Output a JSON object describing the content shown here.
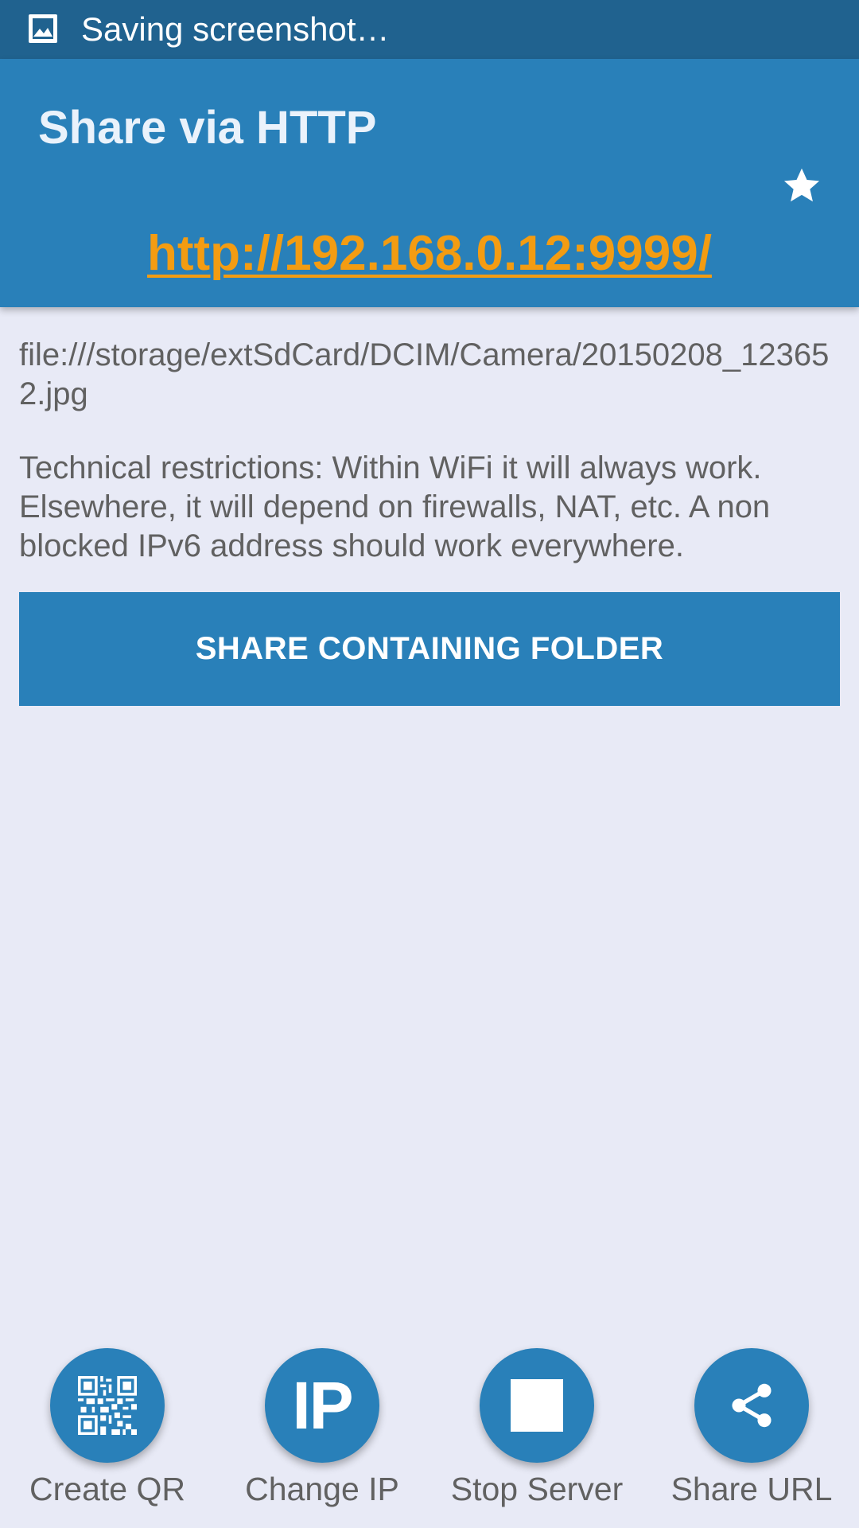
{
  "status_bar": {
    "notification_text": "Saving screenshot…",
    "icon": "image-icon"
  },
  "app_bar": {
    "title": "Share via HTTP",
    "action_icon": "star-icon",
    "server_url": "http://192.168.0.12:9999/"
  },
  "content": {
    "file_path": "file:///storage/extSdCard/DCIM/Camera/20150208_123652.jpg",
    "restrictions_text": "Technical restrictions: Within WiFi it will always work. Elsewhere, it will depend on firewalls, NAT, etc. A non blocked IPv6 address should work everywhere.",
    "share_folder_label": "SHARE CONTAINING FOLDER"
  },
  "actions": [
    {
      "label": "Create QR",
      "icon": "qr-code-icon"
    },
    {
      "label": "Change IP",
      "icon": "ip-icon",
      "icon_text": "IP"
    },
    {
      "label": "Stop Server",
      "icon": "stop-icon"
    },
    {
      "label": "Share URL",
      "icon": "share-icon"
    }
  ],
  "colors": {
    "primary": "#2980b9",
    "primary_dark": "#20628f",
    "accent": "#f39c12",
    "background": "#e8eaf6",
    "text": "#616161"
  }
}
